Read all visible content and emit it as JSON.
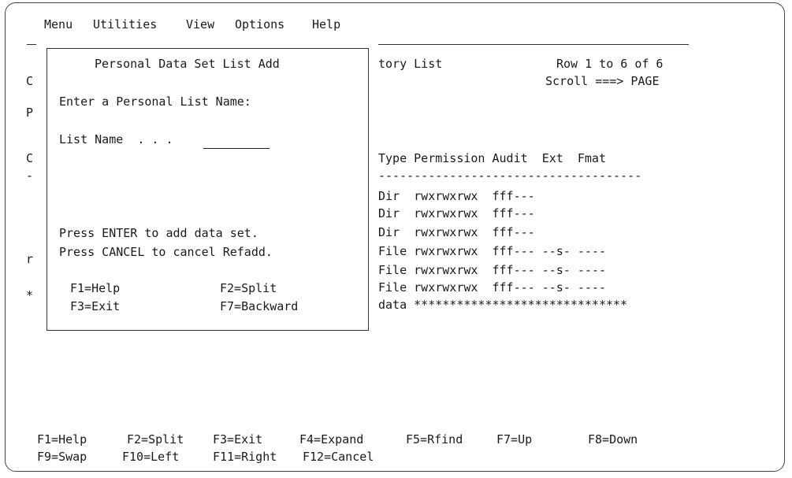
{
  "menubar": {
    "items": [
      "Menu",
      "Utilities",
      "View",
      "Options",
      "Help"
    ]
  },
  "background_panel": {
    "title_fragment": "tory List",
    "row_info": "Row 1 to 6 of 6",
    "scroll": "Scroll ===> PAGE",
    "left_chars": [
      "C",
      "P",
      "C",
      "-",
      "r",
      "*"
    ],
    "column_header": "Type Permission Audit  Ext  Fmat",
    "separator": "-------------------------------------",
    "rows": [
      "Dir  rwxrwxrwx  fff---",
      "Dir  rwxrwxrwx  fff---",
      "Dir  rwxrwxrwx  fff---",
      "File rwxrwxrwx  fff--- --s- ----",
      "File rwxrwxrwx  fff--- --s- ----",
      "File rwxrwxrwx  fff--- --s- ----"
    ],
    "bottom_row": "data ******************************"
  },
  "popup": {
    "title": "Personal Data Set List Add",
    "prompt": "Enter a Personal List Name:",
    "field_label": "List Name  . . .",
    "field_value": "",
    "instruction_1": "Press ENTER to add data set.",
    "instruction_2": "Press CANCEL to cancel Refadd.",
    "keys": {
      "f1": "F1=Help",
      "f2": "F2=Split",
      "f3": "F3=Exit",
      "f7": "F7=Backward"
    }
  },
  "function_keys": {
    "row1": [
      {
        "id": "f1",
        "label": "F1=Help"
      },
      {
        "id": "f2",
        "label": "F2=Split"
      },
      {
        "id": "f3",
        "label": "F3=Exit"
      },
      {
        "id": "f4",
        "label": "F4=Expand"
      },
      {
        "id": "f5",
        "label": "F5=Rfind"
      },
      {
        "id": "f7",
        "label": "F7=Up"
      },
      {
        "id": "f8",
        "label": "F8=Down"
      }
    ],
    "row2": [
      {
        "id": "f9",
        "label": "F9=Swap"
      },
      {
        "id": "f10",
        "label": "F10=Left"
      },
      {
        "id": "f11",
        "label": "F11=Right"
      },
      {
        "id": "f12",
        "label": "F12=Cancel"
      }
    ]
  }
}
